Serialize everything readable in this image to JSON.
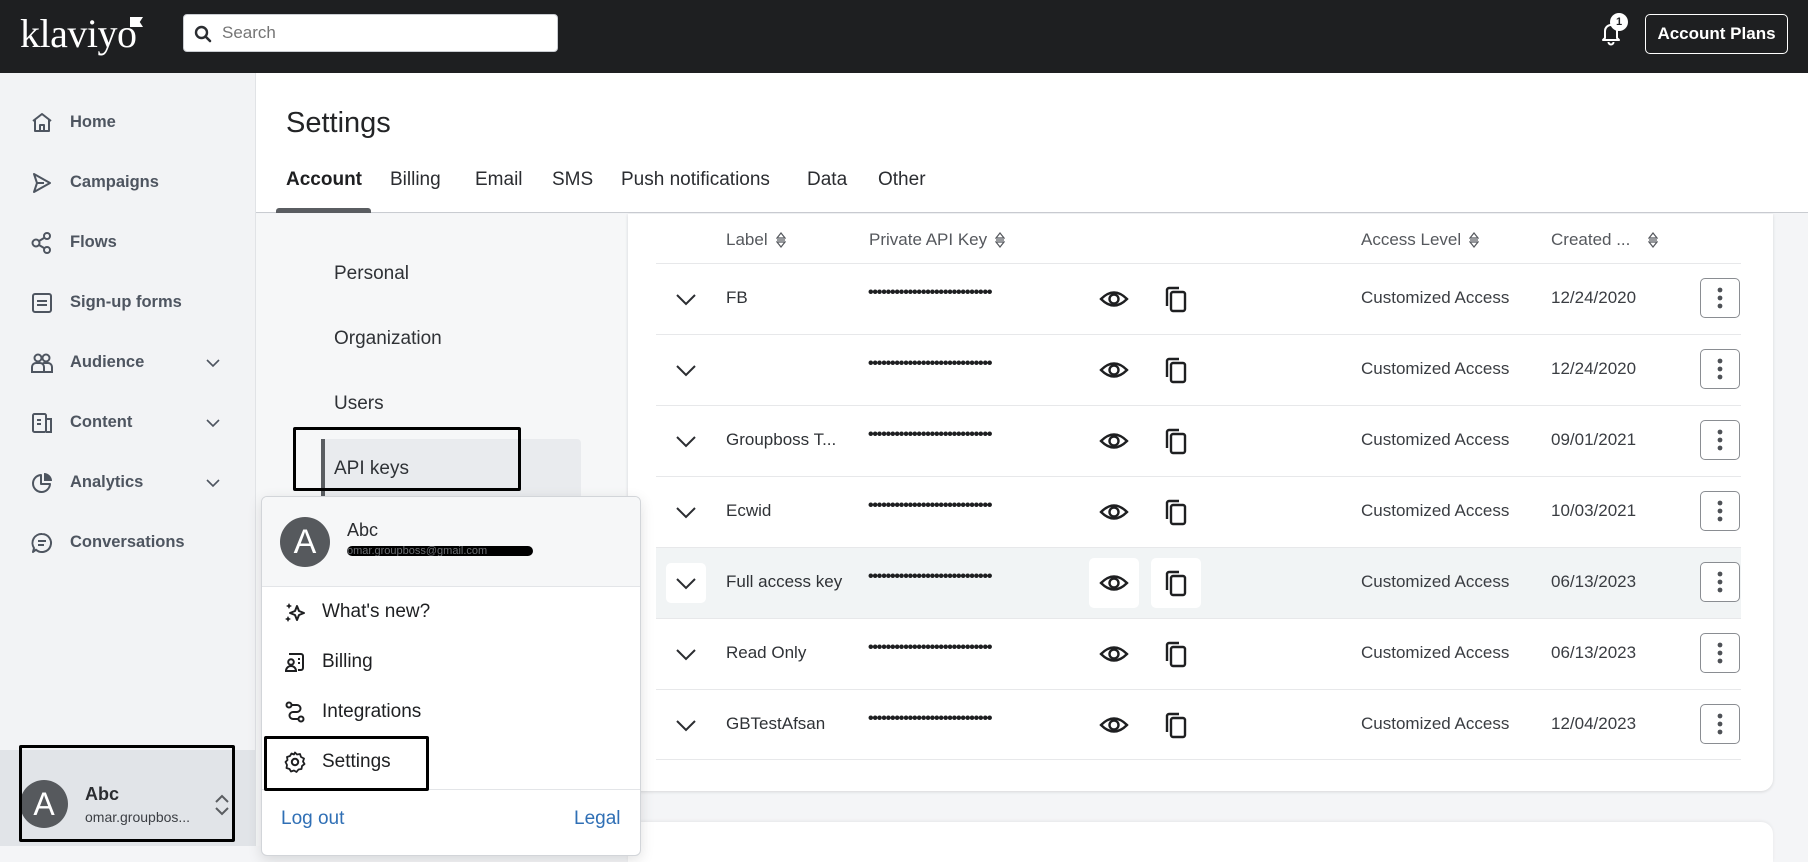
{
  "app": {
    "logo_text": "klaviyo",
    "search_placeholder": "Search",
    "notifications_count": "1",
    "account_plans_label": "Account Plans"
  },
  "sidebar": {
    "items": [
      {
        "label": "Home",
        "icon": "home-icon",
        "has_chevron": false
      },
      {
        "label": "Campaigns",
        "icon": "send-icon",
        "has_chevron": false
      },
      {
        "label": "Flows",
        "icon": "flows-icon",
        "has_chevron": false
      },
      {
        "label": "Sign-up forms",
        "icon": "form-icon",
        "has_chevron": false
      },
      {
        "label": "Audience",
        "icon": "audience-icon",
        "has_chevron": true
      },
      {
        "label": "Content",
        "icon": "content-icon",
        "has_chevron": true
      },
      {
        "label": "Analytics",
        "icon": "analytics-icon",
        "has_chevron": true
      },
      {
        "label": "Conversations",
        "icon": "chat-icon",
        "has_chevron": false
      }
    ],
    "user": {
      "initial": "A",
      "name": "Abc",
      "email": "omar.groupbos..."
    }
  },
  "settings": {
    "title": "Settings",
    "tabs": [
      "Account",
      "Billing",
      "Email",
      "SMS",
      "Push notifications",
      "Data",
      "Other"
    ],
    "active_tab": "Account",
    "subnav": [
      "Personal",
      "Organization",
      "Users",
      "API keys"
    ],
    "active_subnav": "API keys"
  },
  "api_keys_table": {
    "columns": [
      "Label",
      "Private API Key",
      "Access Level",
      "Created ..."
    ],
    "masked_key": "••••••••••••••••••••••••••••",
    "rows": [
      {
        "label": "FB",
        "access": "Customized Access",
        "created": "12/24/2020"
      },
      {
        "label": "",
        "access": "Customized Access",
        "created": "12/24/2020"
      },
      {
        "label": "Groupboss T...",
        "access": "Customized Access",
        "created": "09/01/2021"
      },
      {
        "label": "Ecwid",
        "access": "Customized Access",
        "created": "10/03/2021"
      },
      {
        "label": "Full access key",
        "access": "Customized Access",
        "created": "06/13/2023"
      },
      {
        "label": "Read Only",
        "access": "Customized Access",
        "created": "06/13/2023"
      },
      {
        "label": "GBTestAfsan",
        "access": "Customized Access",
        "created": "12/04/2023"
      }
    ]
  },
  "user_menu": {
    "initial": "A",
    "name": "Abc",
    "email_redacted": "omar.groupboss@gmail.com",
    "items": [
      {
        "label": "What's new?",
        "icon": "sparkle-icon"
      },
      {
        "label": "Billing",
        "icon": "billing-icon"
      },
      {
        "label": "Integrations",
        "icon": "integrations-icon"
      },
      {
        "label": "Settings",
        "icon": "gear-icon"
      }
    ],
    "logout_label": "Log out",
    "legal_label": "Legal"
  },
  "colors": {
    "topbar": "#1e1f21",
    "link": "#2f6fb5",
    "sidebar_bg": "#f2f3f5"
  }
}
